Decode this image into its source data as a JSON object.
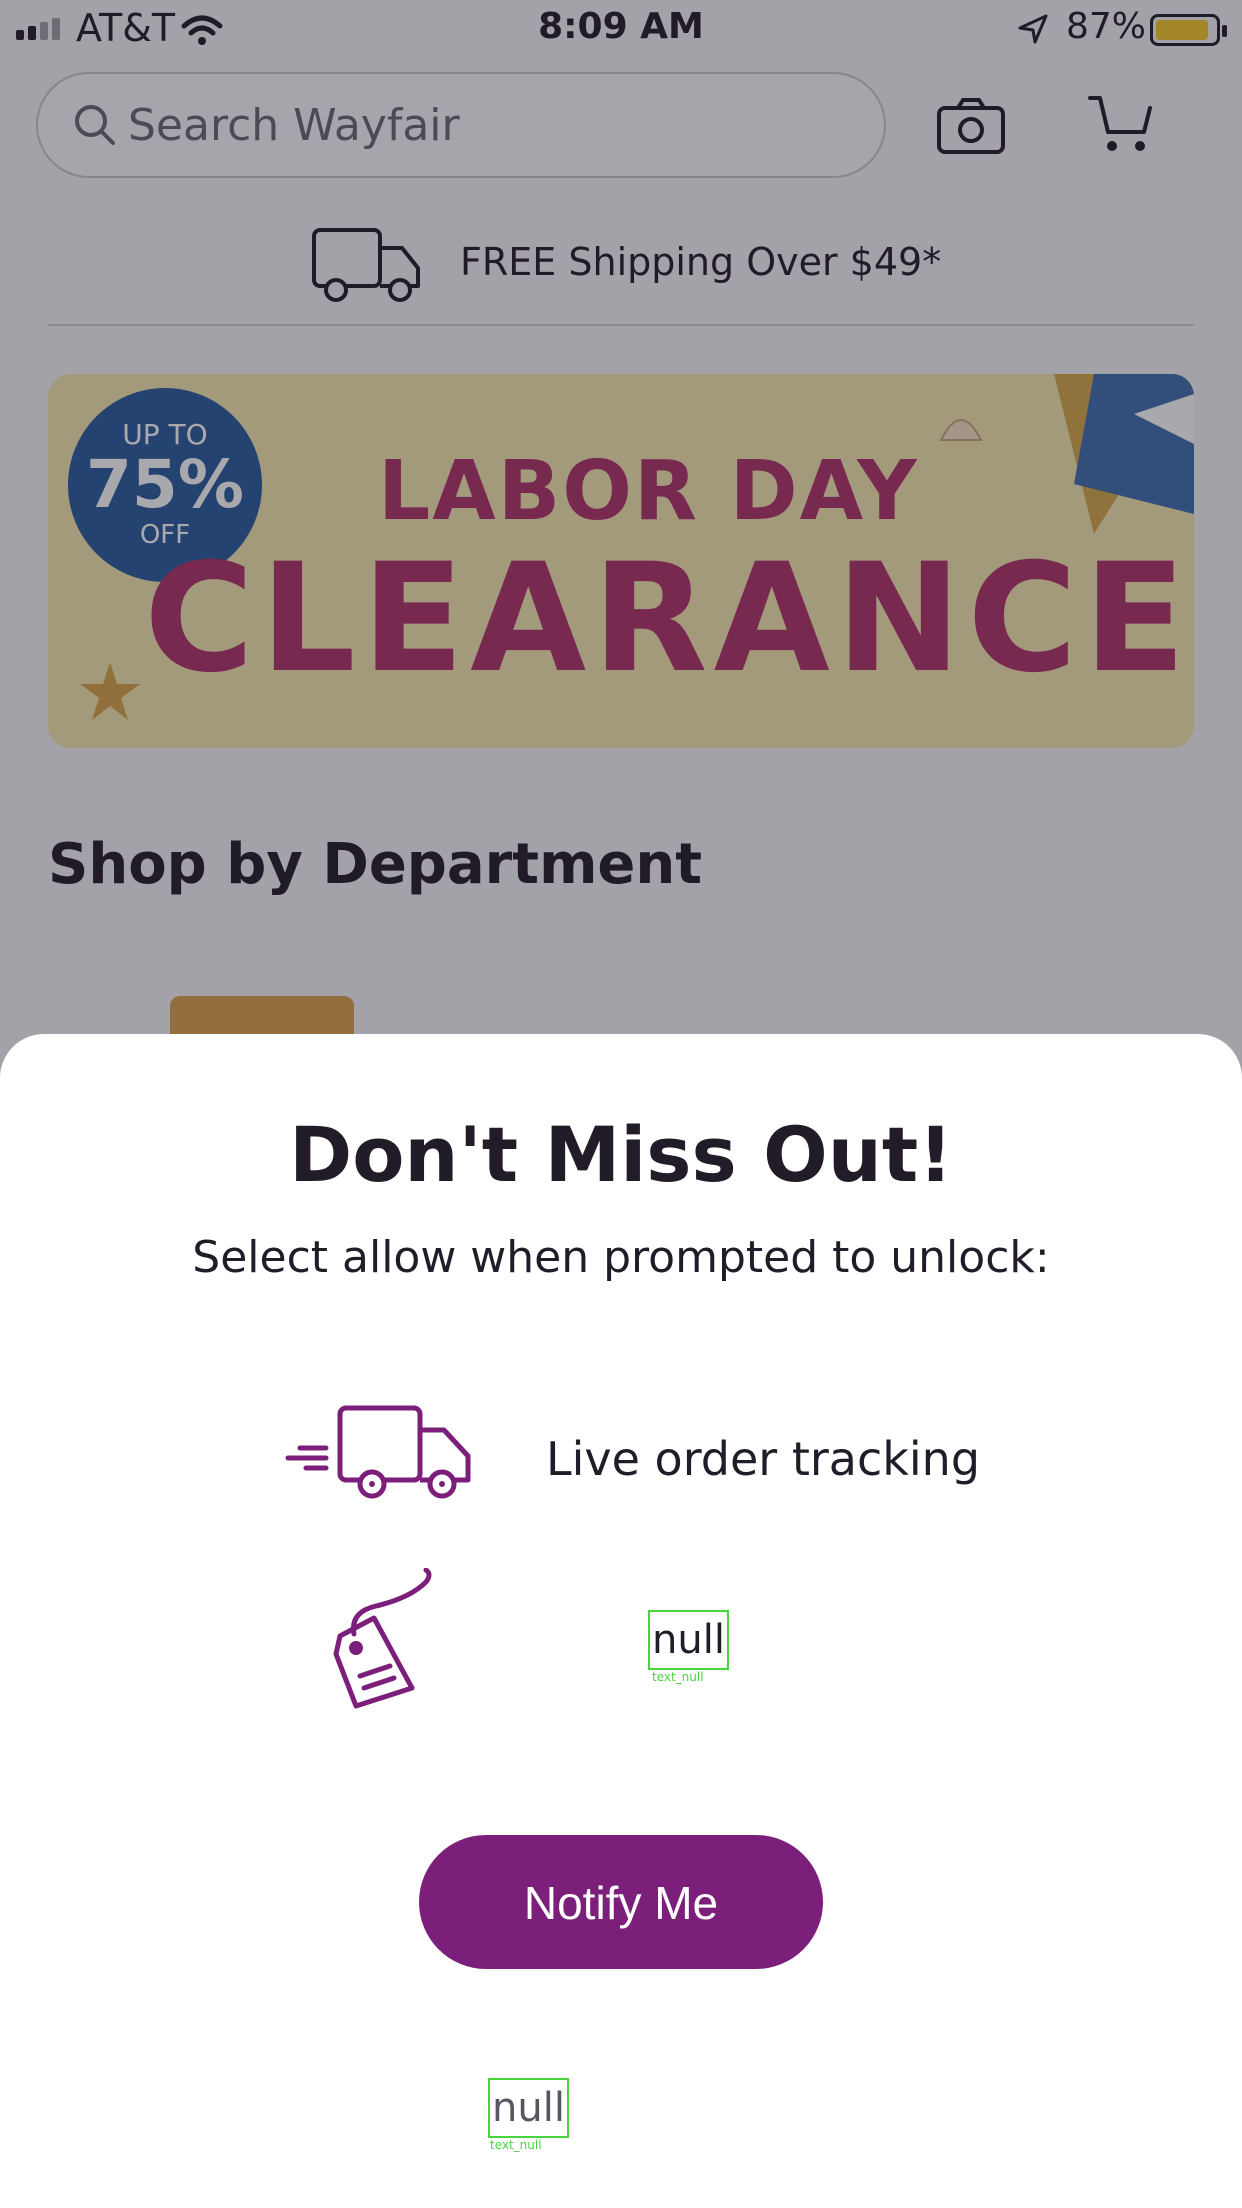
{
  "status_bar": {
    "carrier": "AT&T",
    "time": "8:09 AM",
    "battery": "87%"
  },
  "header": {
    "search_placeholder": "Search Wayfair"
  },
  "shipping": {
    "text": "FREE Shipping Over $49*"
  },
  "banner": {
    "badge_top": "UP TO",
    "badge_value": "75%",
    "badge_bottom": "OFF",
    "line1": "LABOR DAY",
    "line2": "CLEARANCE"
  },
  "section": {
    "title": "Shop by Department"
  },
  "modal": {
    "title": "Don't Miss Out!",
    "subtitle": "Select allow when prompted to unlock:",
    "features": [
      {
        "icon": "delivery-truck-icon",
        "label": "Live order tracking"
      },
      {
        "icon": "price-tag-icon",
        "label": "null",
        "caption": "text_null"
      }
    ],
    "button": "Notify Me",
    "footer": {
      "label": "null",
      "caption": "text_null"
    }
  },
  "colors": {
    "brand_purple": "#7b1f7a",
    "banner_magenta": "#b0336a",
    "banner_blue": "#2b5c9f",
    "overlay": "rgba(30,25,40,0.38)"
  }
}
